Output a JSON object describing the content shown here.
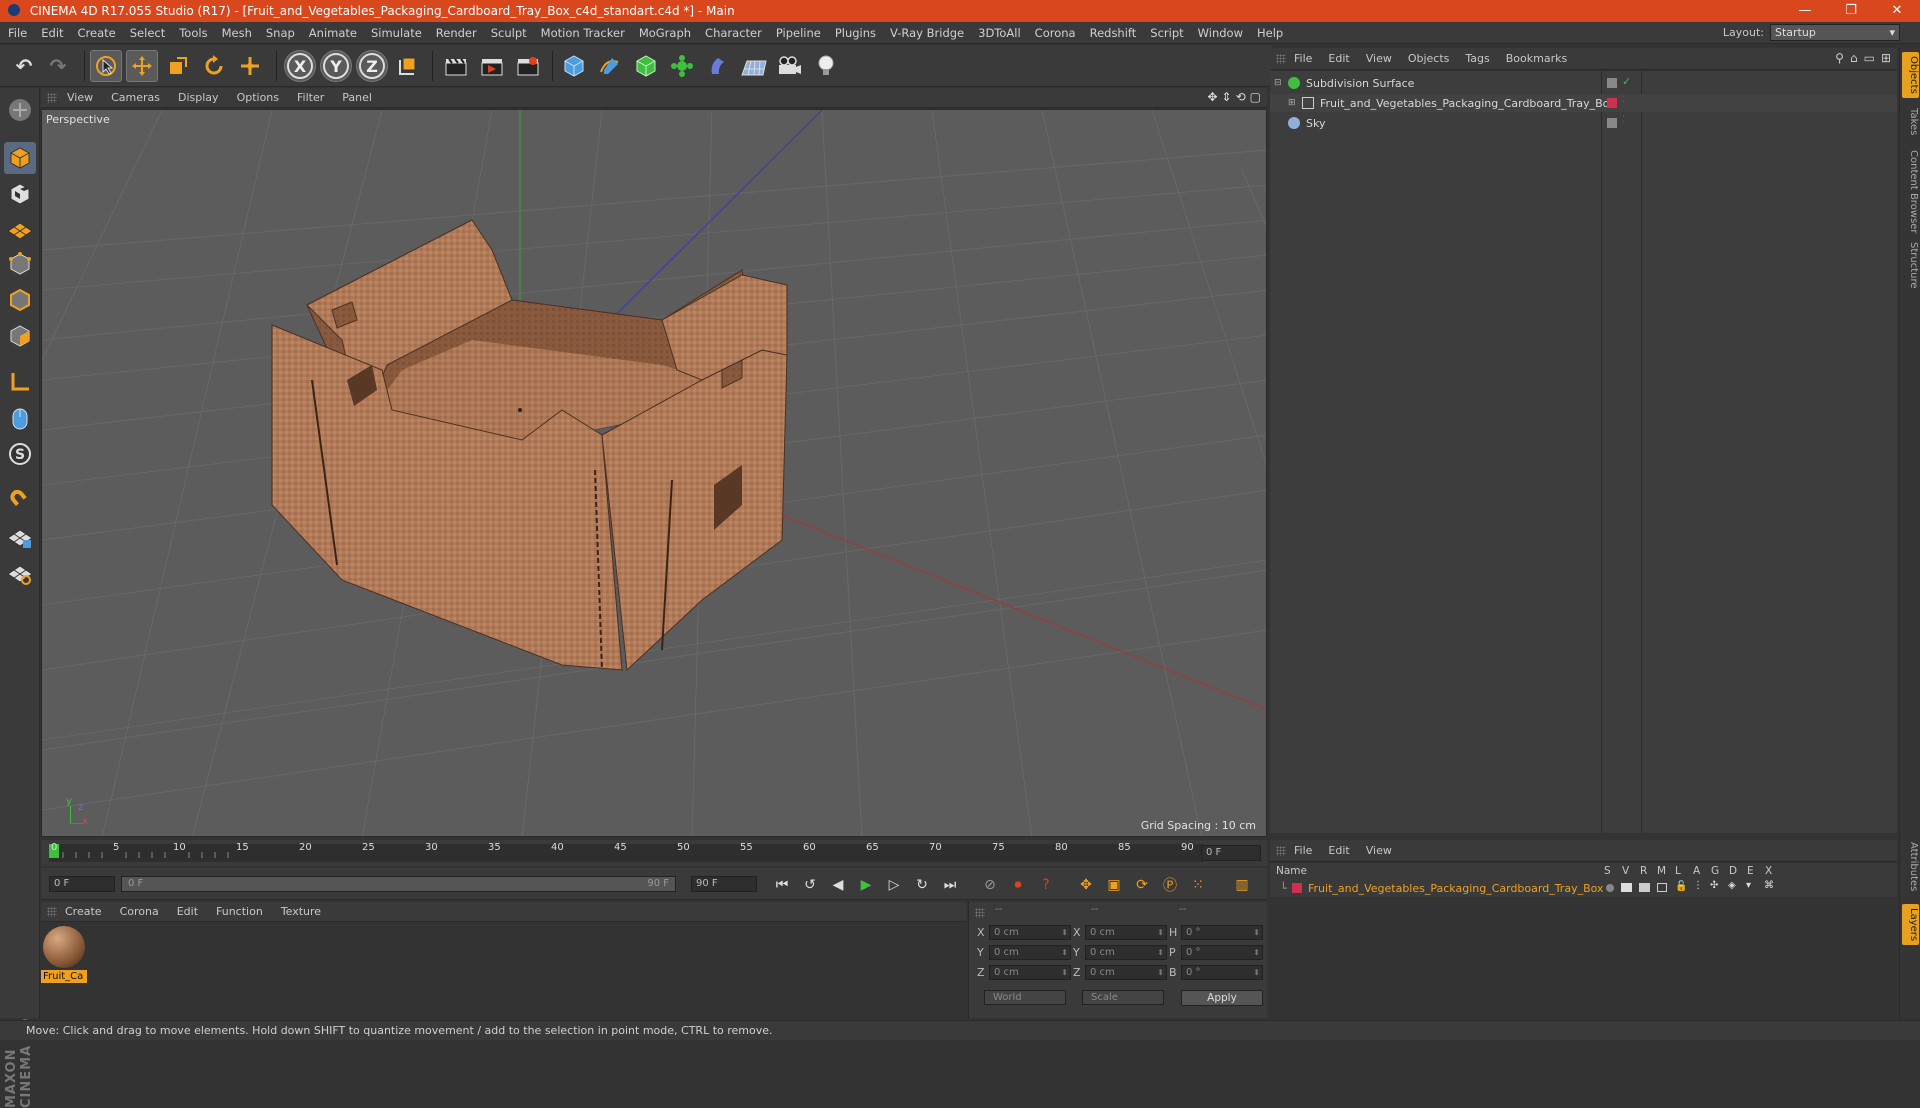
{
  "window": {
    "title": "CINEMA 4D R17.055 Studio (R17) - [Fruit_and_Vegetables_Packaging_Cardboard_Tray_Box_c4d_standart.c4d *] - Main",
    "minimize": "—",
    "maximize": "❐",
    "close": "✕"
  },
  "menubar": {
    "items": [
      "File",
      "Edit",
      "Create",
      "Select",
      "Tools",
      "Mesh",
      "Snap",
      "Animate",
      "Simulate",
      "Render",
      "Sculpt",
      "Motion Tracker",
      "MoGraph",
      "Character",
      "Pipeline",
      "Plugins",
      "V-Ray Bridge",
      "3DToAll",
      "Corona",
      "Redshift",
      "Script",
      "Window",
      "Help"
    ],
    "layout_label": "Layout:",
    "layout_value": "Startup"
  },
  "toolbar": {
    "undo": "↶",
    "redo": "↷",
    "axis_x": "X",
    "axis_y": "Y",
    "axis_z": "Z"
  },
  "viewport": {
    "menu": [
      "View",
      "Cameras",
      "Display",
      "Options",
      "Filter",
      "Panel"
    ],
    "label": "Perspective",
    "grid_spacing": "Grid Spacing : 10 cm",
    "axis_y": "y",
    "axis_z": "z",
    "axis_x": "x"
  },
  "timeline": {
    "ticks": [
      "0",
      "5",
      "10",
      "15",
      "20",
      "25",
      "30",
      "35",
      "40",
      "45",
      "50",
      "55",
      "60",
      "65",
      "70",
      "75",
      "80",
      "85",
      "90"
    ],
    "current_frame": "0 F",
    "start_frame": "0 F",
    "range_start": "0 F",
    "range_end": "90 F",
    "end_frame": "90 F"
  },
  "material_manager": {
    "menu": [
      "Create",
      "Corona",
      "Edit",
      "Function",
      "Texture"
    ],
    "material_name": "Fruit_Ca"
  },
  "coordinates": {
    "headers": [
      "--",
      "--",
      "--"
    ],
    "rows": [
      {
        "axis1": "X",
        "v1": "0 cm",
        "axis2": "X",
        "v2": "0 cm",
        "axis3": "H",
        "v3": "0 °"
      },
      {
        "axis1": "Y",
        "v1": "0 cm",
        "axis2": "Y",
        "v2": "0 cm",
        "axis3": "P",
        "v3": "0 °"
      },
      {
        "axis1": "Z",
        "v1": "0 cm",
        "axis2": "Z",
        "v2": "0 cm",
        "axis3": "B",
        "v3": "0 °"
      }
    ],
    "mode": "World",
    "transform": "Scale",
    "apply": "Apply"
  },
  "status": "Move: Click and drag to move elements. Hold down SHIFT to quantize movement / add to the selection in point mode, CTRL to remove.",
  "object_manager": {
    "menu": [
      "File",
      "Edit",
      "View",
      "Objects",
      "Tags",
      "Bookmarks"
    ],
    "objects": [
      {
        "name": "Subdivision Surface",
        "color": "#3ec03e"
      },
      {
        "name": "Fruit_and_Vegetables_Packaging_Cardboard_Tray_Box",
        "color": "#cccccc"
      },
      {
        "name": "Sky",
        "color": "#8fb0d8"
      }
    ]
  },
  "side_tabs": [
    "Objects",
    "Takes",
    "Content Browser",
    "Structure",
    "Attributes",
    "Layers"
  ],
  "layer_manager": {
    "menu": [
      "File",
      "Edit",
      "View"
    ],
    "columns": [
      "Name",
      "S",
      "V",
      "R",
      "M",
      "L",
      "A",
      "G",
      "D",
      "E",
      "X"
    ],
    "layer_name": "Fruit_and_Vegetables_Packaging_Cardboard_Tray_Box",
    "layer_color": "#d03050"
  },
  "colors": {
    "title_bar": "#d9471d",
    "accent_orange": "#f0a020",
    "viewport_bg": "#5c5c5c"
  }
}
